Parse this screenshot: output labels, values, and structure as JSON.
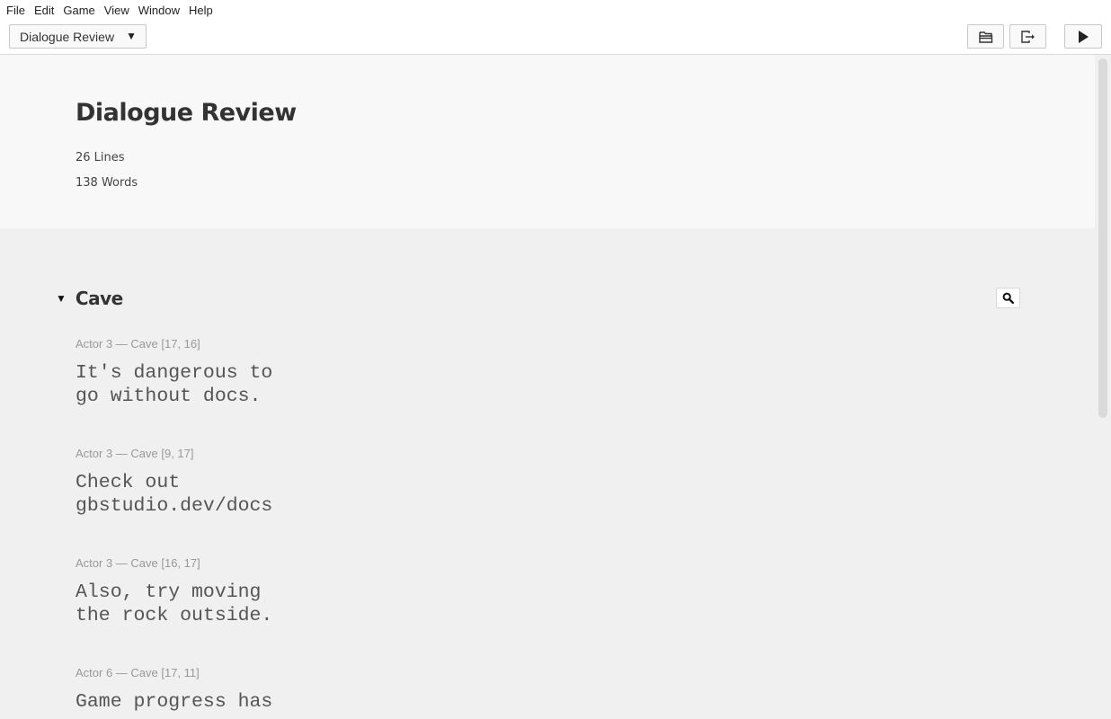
{
  "menu": [
    "File",
    "Edit",
    "Game",
    "View",
    "Window",
    "Help"
  ],
  "toolbar": {
    "section_select": "Dialogue Review",
    "open_folder_icon": "folder-open-icon",
    "export_icon": "export-icon",
    "play_icon": "play-icon"
  },
  "header": {
    "title": "Dialogue Review",
    "lines": "26 Lines",
    "words": "138 Words"
  },
  "scene": {
    "name": "Cave",
    "expanded": true,
    "lines": [
      {
        "meta": "Actor 3 — Cave [17, 16]",
        "text": "It's dangerous to\ngo without docs."
      },
      {
        "meta": "Actor 3 — Cave [9, 17]",
        "text": "Check out\ngbstudio.dev/docs"
      },
      {
        "meta": "Actor 3 — Cave [16, 17]",
        "text": "Also, try moving\nthe rock outside."
      },
      {
        "meta": "Actor 6 — Cave [17, 11]",
        "text": "Game progress has"
      }
    ]
  }
}
